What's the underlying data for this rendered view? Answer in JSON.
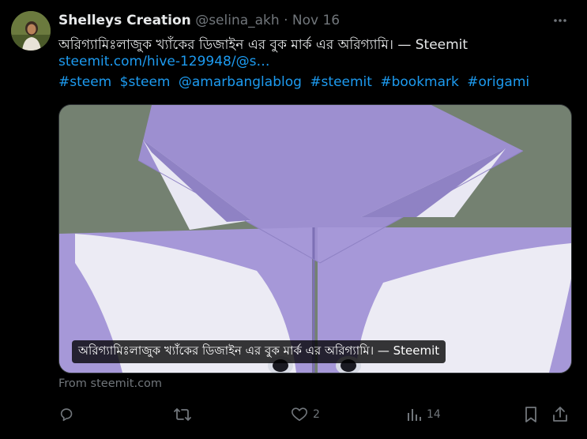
{
  "author": {
    "name": "Shelleys Creation",
    "handle": "@selina_akh",
    "separator": "·",
    "date": "Nov 16"
  },
  "post": {
    "text": "অরিগ্যামিঃলাজুক খ্যাঁকের  ডিজাইন এর বুক মার্ক এর অরিগ্যামি। — Steemit",
    "link": "steemit.com/hive-129948/@s…",
    "hashtags": [
      "#steem",
      "$steem",
      "@amarbanglablog",
      "#steemit",
      "#bookmark",
      "#origami"
    ]
  },
  "card": {
    "caption": "অরিগ্যামিঃলাজুক খ্যাঁকের ডিজাইন এর বুক মার্ক এর অরিগ্যামি। — Steemit",
    "source": "From steemit.com"
  },
  "actions": {
    "reply_count": "",
    "retweet_count": "",
    "like_count": "2",
    "views_count": "14"
  },
  "colors": {
    "background": "#000000",
    "text": "#e7e9ea",
    "secondary": "#71767b",
    "accent": "#1d9bf0"
  }
}
